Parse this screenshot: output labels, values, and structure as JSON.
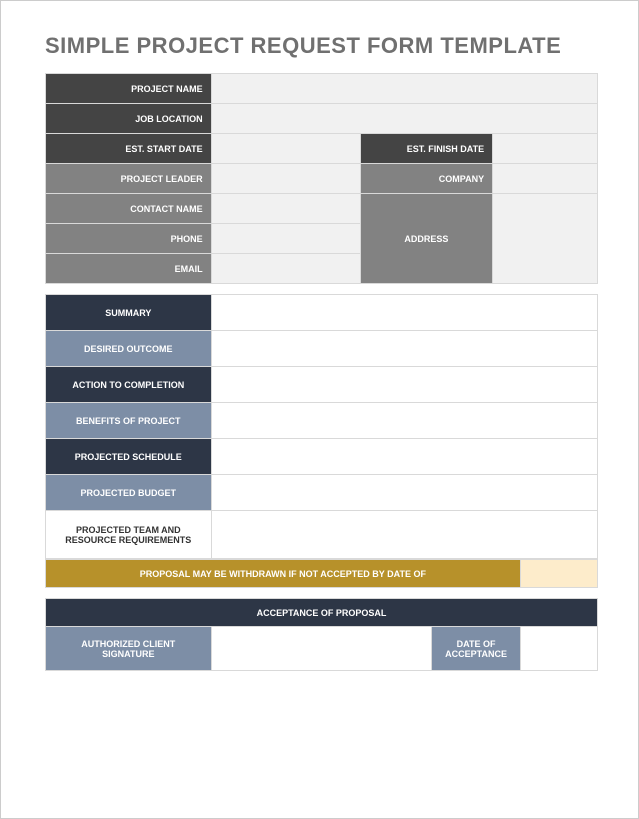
{
  "title": "SIMPLE PROJECT REQUEST FORM TEMPLATE",
  "fields": {
    "project_name": "PROJECT NAME",
    "job_location": "JOB LOCATION",
    "est_start_date": "EST. START DATE",
    "est_finish_date": "EST. FINISH DATE",
    "project_leader": "PROJECT LEADER",
    "company": "COMPANY",
    "contact_name": "CONTACT NAME",
    "address": "ADDRESS",
    "phone": "PHONE",
    "email": "EMAIL"
  },
  "section2": {
    "summary": "SUMMARY",
    "desired_outcome": "DESIRED OUTCOME",
    "action_to_completion": "ACTION TO COMPLETION",
    "benefits": "BENEFITS OF PROJECT",
    "projected_schedule": "PROJECTED SCHEDULE",
    "projected_budget": "PROJECTED BUDGET",
    "team_resource": "PROJECTED TEAM AND RESOURCE REQUIREMENTS"
  },
  "withdrawal_notice": "PROPOSAL MAY BE WITHDRAWN IF NOT ACCEPTED BY DATE OF",
  "acceptance": {
    "header": "ACCEPTANCE OF PROPOSAL",
    "signature": "AUTHORIZED CLIENT SIGNATURE",
    "date": "DATE OF ACCEPTANCE"
  }
}
